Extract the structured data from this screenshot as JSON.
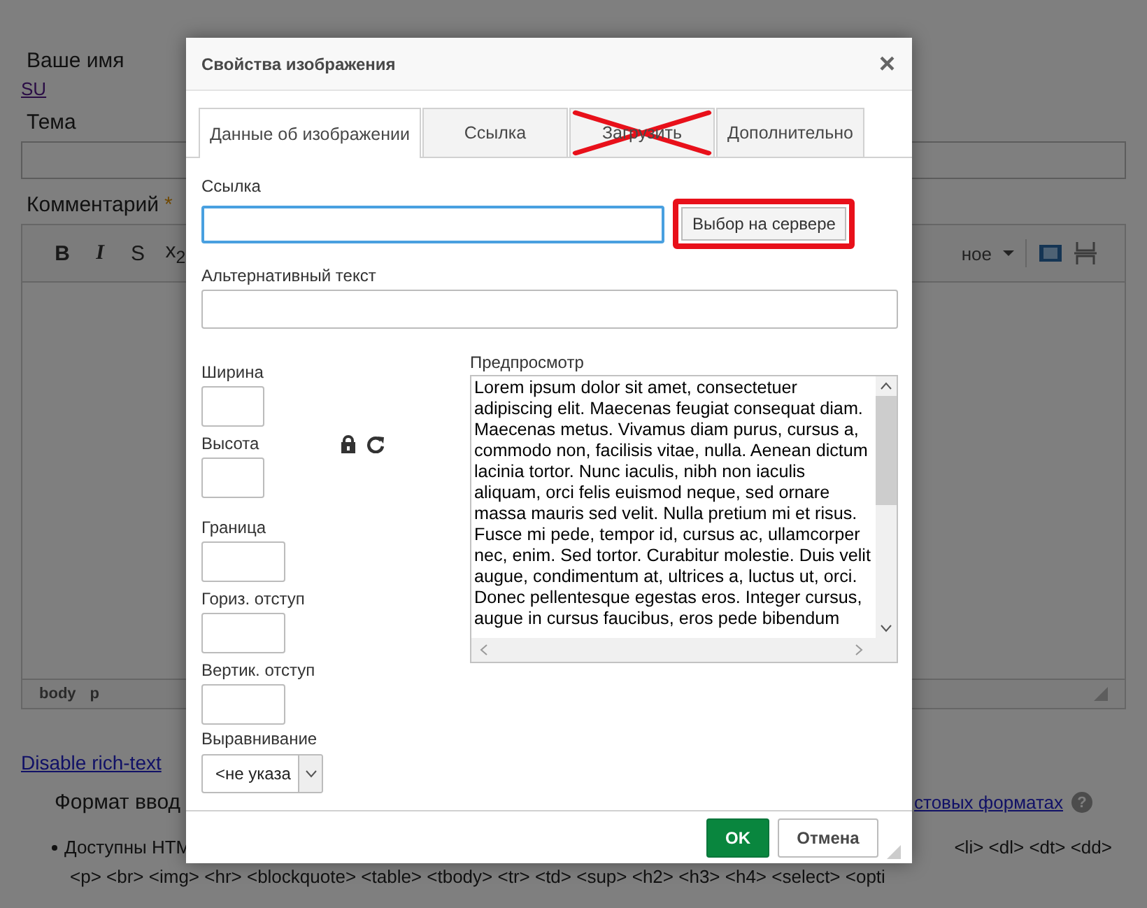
{
  "page": {
    "name_label": "Ваше имя",
    "name_link": "SU",
    "subject_label": "Тема",
    "comment_label": "Комментарий",
    "required_mark": "*",
    "toolbar": [
      {
        "kind": "bold",
        "text": "B"
      },
      {
        "kind": "italic",
        "text": "I"
      },
      {
        "kind": "strike",
        "text": "S"
      },
      {
        "kind": "sub",
        "text": "x$_{2}$"
      }
    ],
    "format_fragment": "ное",
    "path": [
      "body",
      "p"
    ],
    "disable_link": "Disable rich-text",
    "format_label": "Формат ввод",
    "formats_link": "стовых форматах",
    "help": "?",
    "allowed_left": "Доступны HTM",
    "allowed_right": "<li> <dl> <dt> <dd>",
    "allowed_line2": "<p> <br> <img> <hr> <blockquote> <table> <tbody> <tr> <td> <sup> <h2> <h3> <h4> <select> <opti"
  },
  "dialog": {
    "title": "Свойства изображения",
    "close": "×",
    "tabs": [
      {
        "label": "Данные об изображении",
        "selected": true,
        "crossed_out": false
      },
      {
        "label": "Ссылка",
        "selected": false,
        "crossed_out": false
      },
      {
        "label": "Загрузить",
        "selected": false,
        "crossed_out": true
      },
      {
        "label": "Дополнительно",
        "selected": false,
        "crossed_out": false
      }
    ],
    "url_label": "Ссылка",
    "url_focused": true,
    "browse_button": {
      "label": "Выбор на сервере",
      "highlighted": true
    },
    "alt_label": "Альтернативный текст",
    "fields": [
      {
        "label": "Ширина",
        "kind": "small"
      },
      {
        "label": "Высота",
        "kind": "small",
        "lock": true
      },
      {
        "label": "Граница",
        "kind": "wide"
      },
      {
        "label": "Гориз. отступ",
        "kind": "wide"
      },
      {
        "label": "Вертик. отступ",
        "kind": "wide"
      }
    ],
    "align_label": "Выравнивание",
    "align_value": "<не указа",
    "preview_label": "Предпросмотр",
    "preview_text": "Lorem ipsum dolor sit amet, consectetuer adipiscing elit. Maecenas feugiat consequat diam. Maecenas metus. Vivamus diam purus, cursus a, commodo non, facilisis vitae, nulla. Aenean dictum lacinia tortor. Nunc iaculis, nibh non iaculis aliquam, orci felis euismod neque, sed ornare massa mauris sed velit. Nulla pretium mi et risus. Fusce mi pede, tempor id, cursus ac, ullamcorper nec, enim. Sed tortor. Curabitur molestie. Duis velit augue, condimentum at, ultrices a, luctus ut, orci. Donec pellentesque egestas eros. Integer cursus, augue in cursus faucibus, eros pede bibendum",
    "buttons": [
      {
        "label": "OK",
        "kind": "primary"
      },
      {
        "label": "Отмена",
        "kind": "secondary"
      }
    ]
  }
}
